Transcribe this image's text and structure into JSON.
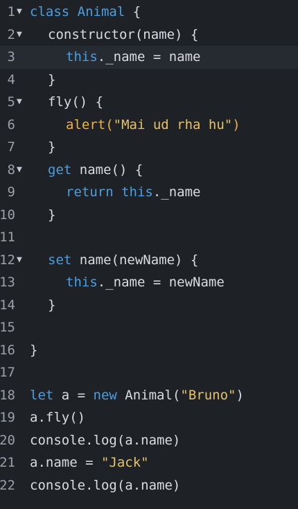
{
  "editor": {
    "language": "javascript",
    "active_line": 3,
    "lines": [
      {
        "n": "1",
        "fold": true,
        "indent": 0,
        "tokens": [
          {
            "t": "class",
            "c": "kw"
          },
          {
            "t": " "
          },
          {
            "t": "Animal",
            "c": "cls"
          },
          {
            "t": " {"
          }
        ]
      },
      {
        "n": "2",
        "fold": true,
        "indent": 1,
        "tokens": [
          {
            "t": "constructor(name) {"
          }
        ]
      },
      {
        "n": "3",
        "fold": false,
        "indent": 2,
        "tokens": [
          {
            "t": "this",
            "c": "kw"
          },
          {
            "t": "._name = name"
          }
        ]
      },
      {
        "n": "4",
        "fold": false,
        "indent": 1,
        "tokens": [
          {
            "t": "}"
          }
        ]
      },
      {
        "n": "5",
        "fold": true,
        "indent": 1,
        "tokens": [
          {
            "t": "fly() {"
          }
        ]
      },
      {
        "n": "6",
        "fold": false,
        "indent": 2,
        "tokens": [
          {
            "t": "alert(",
            "c": "fn"
          },
          {
            "t": "\"Mai ud rha hu\"",
            "c": "str"
          },
          {
            "t": ")",
            "c": "fn"
          }
        ]
      },
      {
        "n": "7",
        "fold": false,
        "indent": 1,
        "tokens": [
          {
            "t": "}"
          }
        ]
      },
      {
        "n": "8",
        "fold": true,
        "indent": 1,
        "tokens": [
          {
            "t": "get",
            "c": "kw"
          },
          {
            "t": " name() {"
          }
        ]
      },
      {
        "n": "9",
        "fold": false,
        "indent": 2,
        "tokens": [
          {
            "t": "return",
            "c": "kw"
          },
          {
            "t": " "
          },
          {
            "t": "this",
            "c": "kw"
          },
          {
            "t": "._name"
          }
        ]
      },
      {
        "n": "10",
        "fold": false,
        "indent": 1,
        "tokens": [
          {
            "t": "}"
          }
        ]
      },
      {
        "n": "11",
        "fold": false,
        "indent": 0,
        "tokens": []
      },
      {
        "n": "12",
        "fold": true,
        "indent": 1,
        "tokens": [
          {
            "t": "set",
            "c": "kw"
          },
          {
            "t": " name(newName) {"
          }
        ]
      },
      {
        "n": "13",
        "fold": false,
        "indent": 2,
        "tokens": [
          {
            "t": "this",
            "c": "kw"
          },
          {
            "t": "._name = newName"
          }
        ]
      },
      {
        "n": "14",
        "fold": false,
        "indent": 1,
        "tokens": [
          {
            "t": "}"
          }
        ]
      },
      {
        "n": "15",
        "fold": false,
        "indent": 0,
        "tokens": []
      },
      {
        "n": "16",
        "fold": false,
        "indent": 0,
        "tokens": [
          {
            "t": "}"
          }
        ]
      },
      {
        "n": "17",
        "fold": false,
        "indent": 0,
        "tokens": []
      },
      {
        "n": "18",
        "fold": false,
        "indent": 0,
        "tokens": [
          {
            "t": "let",
            "c": "kw"
          },
          {
            "t": " a = "
          },
          {
            "t": "new",
            "c": "kw"
          },
          {
            "t": " Animal("
          },
          {
            "t": "\"Bruno\"",
            "c": "str"
          },
          {
            "t": ")"
          }
        ]
      },
      {
        "n": "19",
        "fold": false,
        "indent": 0,
        "tokens": [
          {
            "t": "a.fly()"
          }
        ]
      },
      {
        "n": "20",
        "fold": false,
        "indent": 0,
        "tokens": [
          {
            "t": "console.log(a.name)"
          }
        ]
      },
      {
        "n": "21",
        "fold": false,
        "indent": 0,
        "tokens": [
          {
            "t": "a.name = "
          },
          {
            "t": "\"Jack\"",
            "c": "str"
          }
        ]
      },
      {
        "n": "22",
        "fold": false,
        "indent": 0,
        "tokens": [
          {
            "t": "console.log(a.name)"
          }
        ]
      }
    ],
    "fold_icon": "▼",
    "colors": {
      "background": "#1e2227",
      "keyword": "#4a9fe3",
      "string": "#e6c36a",
      "function_call": "#f0b04a",
      "text": "#d9dde2",
      "line_number": "#9aa1a9"
    }
  }
}
